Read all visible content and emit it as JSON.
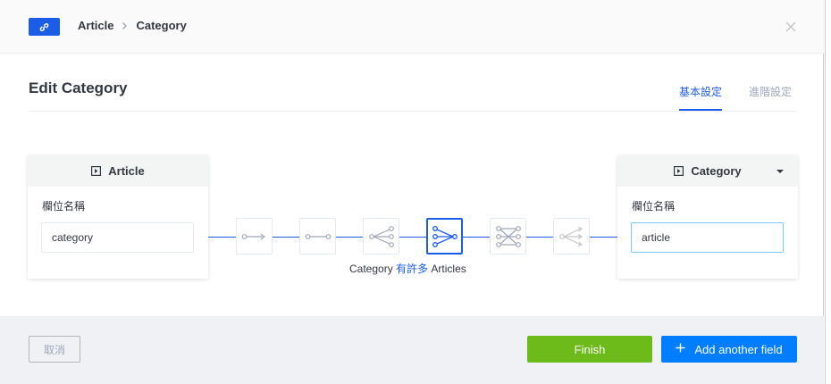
{
  "header": {
    "badge_icon": "link-icon",
    "breadcrumb": [
      "Article",
      "Category"
    ],
    "close_icon": "close-icon"
  },
  "title": "Edit Category",
  "tabs": [
    {
      "label": "基本設定",
      "active": true
    },
    {
      "label": "進階設定",
      "active": false
    }
  ],
  "left_model": {
    "name": "Article",
    "icon": "content-type-icon",
    "field_label": "欄位名稱",
    "field_value": "category"
  },
  "right_model": {
    "name": "Category",
    "icon": "content-type-icon",
    "field_label": "欄位名稱",
    "field_value": "article"
  },
  "relations": [
    {
      "icon": "one-way-relation-icon",
      "active": false
    },
    {
      "icon": "one-to-one-relation-icon",
      "active": false
    },
    {
      "icon": "one-to-many-relation-icon",
      "active": false
    },
    {
      "icon": "many-to-one-relation-icon",
      "active": true
    },
    {
      "icon": "many-to-many-relation-icon",
      "active": false
    },
    {
      "icon": "many-way-relation-icon",
      "active": false
    }
  ],
  "relation_caption": {
    "left": "Category",
    "keyword": "有許多",
    "right": "Articles"
  },
  "footer": {
    "cancel_label": "取消",
    "finish_label": "Finish",
    "add_label": "Add another field",
    "add_icon": "plus-icon"
  },
  "colors": {
    "primary": "#1c5de7",
    "finish": "#6dbb1a",
    "add": "#007eff",
    "footer_bg": "#eff1f5"
  }
}
